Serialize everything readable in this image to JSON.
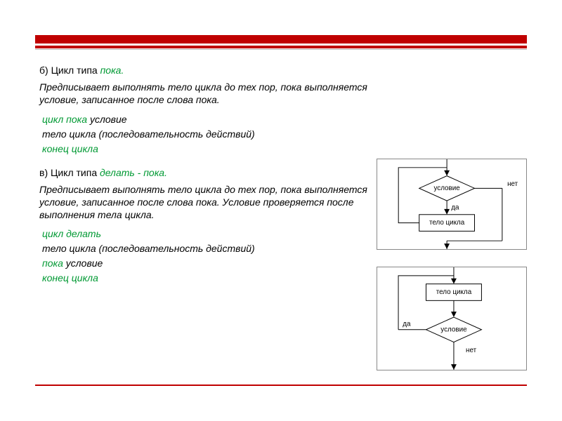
{
  "sectionB": {
    "heading_prefix": "б) Цикл типа ",
    "heading_keyword": "пока.",
    "description": "Предписывает выполнять тело цикла до тех пор, пока выполняется условие, записанное после слова пока.",
    "code": {
      "line1_kw": "цикл пока",
      "line1_rest": " условие",
      "line2": "тело цикла (последовательность действий)",
      "line3": "конец цикла"
    },
    "flow": {
      "condition": "условие",
      "body": "тело цикла",
      "no": "нет",
      "yes": "да"
    }
  },
  "sectionC": {
    "heading_prefix": "в) Цикл типа ",
    "heading_keyword": "делать - пока.",
    "description": "Предписывает выполнять тело цикла до тех пор, пока выполняется условие, записанное после слова пока. Условие проверяется после выполнения тела цикла.",
    "code": {
      "line1": "цикл делать",
      "line2": "тело цикла (последовательность действий)",
      "line3_kw": "пока",
      "line3_rest": " условие",
      "line4": "конец цикла"
    },
    "flow": {
      "condition": "условие",
      "body": "тело цикла",
      "no": "нет",
      "yes": "да"
    }
  }
}
